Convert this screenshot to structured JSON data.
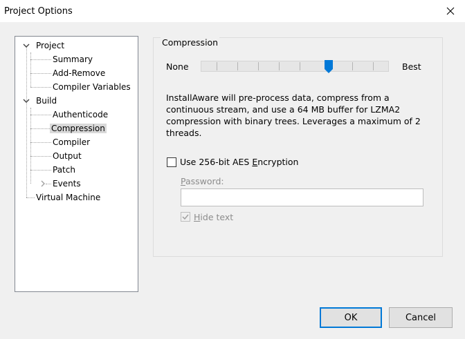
{
  "window": {
    "title": "Project Options"
  },
  "tree": {
    "project": {
      "label": "Project"
    },
    "summary": {
      "label": "Summary"
    },
    "add_remove": {
      "label": "Add-Remove"
    },
    "compiler_variables": {
      "label": "Compiler Variables"
    },
    "build": {
      "label": "Build"
    },
    "authenticode": {
      "label": "Authenticode"
    },
    "compression": {
      "label": "Compression"
    },
    "compiler": {
      "label": "Compiler"
    },
    "output": {
      "label": "Output"
    },
    "patch": {
      "label": "Patch"
    },
    "events": {
      "label": "Events"
    },
    "virtual_machine": {
      "label": "Virtual Machine"
    },
    "selected": "Compression"
  },
  "compression": {
    "group_title": "Compression",
    "min_label": "None",
    "max_label": "Best",
    "level": 7,
    "level_max": 10,
    "description": "InstallAware will pre-process data, compress from a continuous stream, and use a 64 MB buffer for LZMA2 compression with binary trees. Leverages a maximum of 2 threads."
  },
  "encryption": {
    "checkbox_pre": "Use 256-bit AES ",
    "checkbox_mnemonic": "E",
    "checkbox_post": "ncryption",
    "checked": false,
    "password_mnemonic": "P",
    "password_rest": "assword:",
    "password_value": "",
    "hide_mnemonic": "H",
    "hide_rest": "ide text",
    "hide_checked": true
  },
  "buttons": {
    "ok": "OK",
    "cancel": "Cancel"
  },
  "colors": {
    "accent": "#0078d7",
    "selection": "#d9d9d9"
  }
}
